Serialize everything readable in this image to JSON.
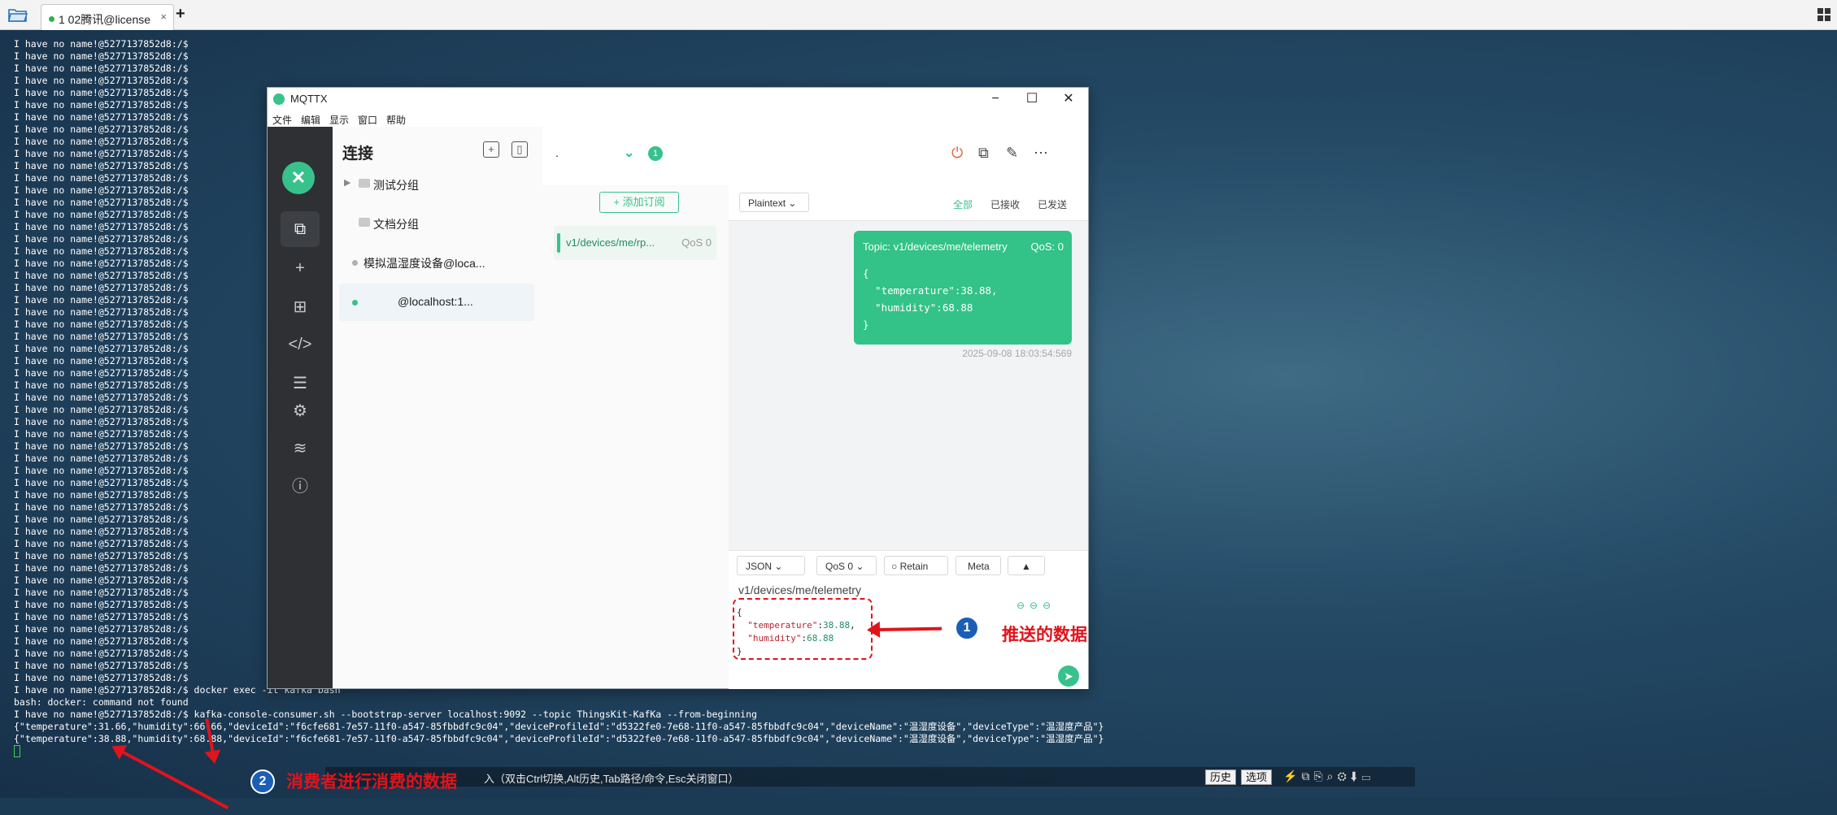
{
  "terminal_app": {
    "tab_label": "1 02腾讯@license",
    "tab_close": "×",
    "new_tab": "+"
  },
  "terminal": {
    "prompt_line": "I have no name!@5277137852d8:/$",
    "bottom_lines": [
      "I have no name!@5277137852d8:/$ docker exec -it kafka bash",
      "bash: docker: command not found",
      "I have no name!@5277137852d8:/$ kafka-console-consumer.sh --bootstrap-server localhost:9092 --topic ThingsKit-KafKa --from-beginning",
      "{\"temperature\":31.66,\"humidity\":66.66,\"deviceId\":\"f6cfe681-7e57-11f0-a547-85fbbdfc9c04\",\"deviceProfileId\":\"d5322fe0-7e68-11f0-a547-85fbbdfc9c04\",\"deviceName\":\"温湿度设备\",\"deviceType\":\"温湿度产品\"}",
      "{\"temperature\":38.88,\"humidity\":68.88,\"deviceId\":\"f6cfe681-7e57-11f0-a547-85fbbdfc9c04\",\"deviceProfileId\":\"d5322fe0-7e68-11f0-a547-85fbbdfc9c04\",\"deviceName\":\"温湿度设备\",\"deviceType\":\"温湿度产品\"}"
    ]
  },
  "statusbar": {
    "hint": "入（双击Ctrl切换,Alt历史,Tab路径/命令,Esc关闭窗口）",
    "history_btn": "历史",
    "options_btn": "选项"
  },
  "mqttx": {
    "title": "MQTTX",
    "menu": [
      "文件",
      "编辑",
      "显示",
      "窗口",
      "帮助"
    ],
    "window_buttons": {
      "minimize": "−",
      "maximize": "☐",
      "close": "✕"
    },
    "connections": {
      "heading": "连接",
      "items": [
        {
          "label": "测试分组",
          "type": "group"
        },
        {
          "label": "文档分组",
          "type": "group"
        },
        {
          "label": "模拟温湿度设备@loca...",
          "type": "connection",
          "status_color": "#b0b0b0"
        },
        {
          "label": "@localhost:1...",
          "type": "connection",
          "status_color": "#37c28c"
        }
      ]
    },
    "header": {
      "connection_name": ".",
      "badge": "1"
    },
    "subscriptions": {
      "add_button": "+ 添加订阅",
      "items": [
        {
          "topic": "v1/devices/me/rp...",
          "qos": "QoS 0"
        }
      ]
    },
    "messages": {
      "format": "Plaintext",
      "filters": [
        "全部",
        "已接收",
        "已发送"
      ],
      "message": {
        "topic": "Topic: v1/devices/me/telemetry",
        "qos": "QoS: 0",
        "payload": "{\n  \"temperature\":38.88,\n  \"humidity\":68.88\n}",
        "time": "2025-09-08 18:03:54:569"
      }
    },
    "composer": {
      "payload_type": "JSON",
      "qos": "QoS 0",
      "retain": "Retain",
      "meta": "Meta",
      "topic": "v1/devices/me/telemetry"
    }
  },
  "annotations": {
    "pushed_label": "推送的数据",
    "pushed_num": "1",
    "consumer_label": "消费者进行消费的数据",
    "consumer_num": "2"
  }
}
